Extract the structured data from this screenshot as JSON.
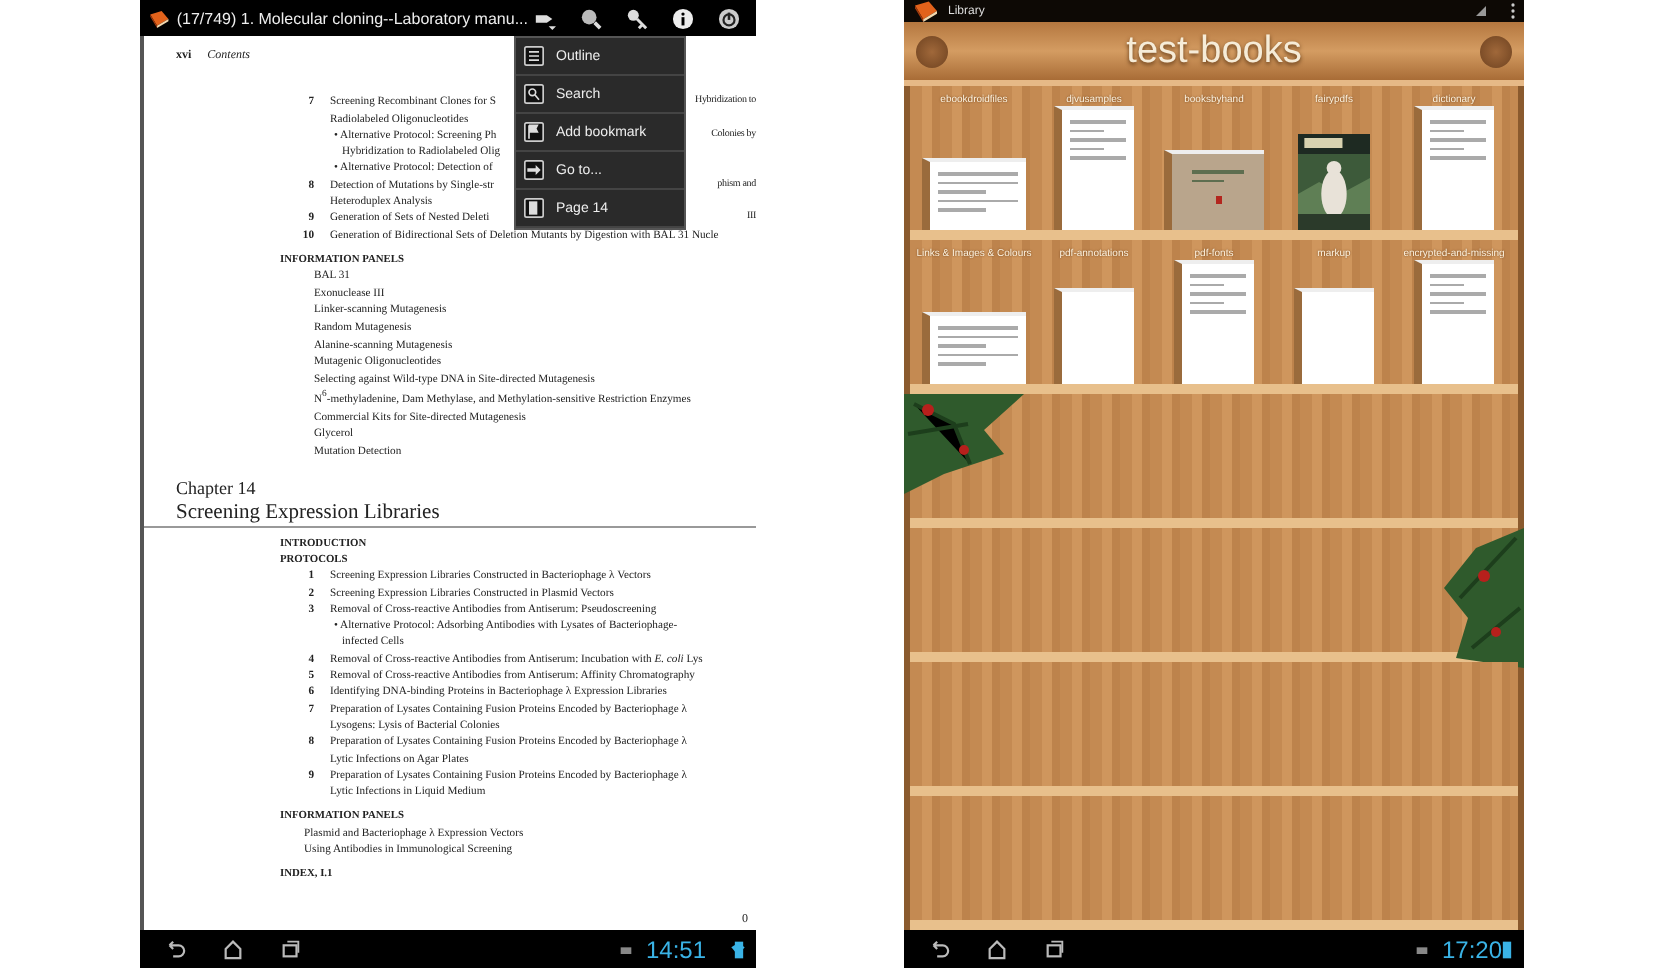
{
  "reader": {
    "title": "(17/749) 1. Molecular cloning--Laboratory manu...",
    "page": {
      "folio": "xvi",
      "running_head": "Contents",
      "entries": [
        {
          "kind": "item",
          "num": "7",
          "lines": [
            {
              "text": "Screening Recombinant Clones for S",
              "tail": "Hybridization to"
            },
            {
              "text": "Radiolabeled Oligonucleotides"
            }
          ]
        },
        {
          "kind": "bullet",
          "lines": [
            {
              "text": "• Alternative Protocol: Screening Ph",
              "tail": "Colonies by"
            },
            {
              "text": "Hybridization to Radiolabeled Olig"
            }
          ]
        },
        {
          "kind": "bullet",
          "lines": [
            {
              "text": "• Alternative Protocol: Detection of"
            }
          ]
        },
        {
          "kind": "item",
          "num": "8",
          "lines": [
            {
              "text": "Detection of Mutations by Single-str",
              "tail": "phism and"
            },
            {
              "text": "Heteroduplex Analysis"
            }
          ]
        },
        {
          "kind": "item",
          "num": "9",
          "lines": [
            {
              "text": "Generation of Sets of Nested Deleti",
              "tail": "III"
            }
          ]
        },
        {
          "kind": "item",
          "num": "10",
          "lines": [
            {
              "text": "Generation of Bidirectional Sets of Deletion Mutants by Digestion with BAL 31 Nucle"
            }
          ]
        },
        {
          "kind": "heading",
          "text": "INFORMATION PANELS"
        },
        {
          "kind": "panel",
          "text": "BAL 31"
        },
        {
          "kind": "panel",
          "text": "Exonuclease III"
        },
        {
          "kind": "panel",
          "text": "Linker-scanning Mutagenesis"
        },
        {
          "kind": "panel",
          "text": "Random Mutagenesis"
        },
        {
          "kind": "panel",
          "text": "Alanine-scanning Mutagenesis"
        },
        {
          "kind": "panel",
          "text": "Mutagenic Oligonucleotides"
        },
        {
          "kind": "panel",
          "text": "Selecting against Wild-type DNA in Site-directed Mutagenesis"
        },
        {
          "kind": "panel",
          "text": "N$^{6}$-methyladenine, Dam Methylase, and Methylation-sensitive Restriction Enzymes"
        },
        {
          "kind": "panel",
          "text": "Commercial Kits for Site-directed Mutagenesis"
        },
        {
          "kind": "panel",
          "text": "Glycerol"
        },
        {
          "kind": "panel",
          "text": "Mutation Detection"
        },
        {
          "kind": "chapter",
          "text": "Chapter 14"
        },
        {
          "kind": "title",
          "text": "Screening Expression Libraries"
        },
        {
          "kind": "heading",
          "text": "INTRODUCTION"
        },
        {
          "kind": "heading2",
          "text": "PROTOCOLS"
        },
        {
          "kind": "item",
          "num": "1",
          "lines": [
            {
              "text": "Screening Expression Libraries Constructed in Bacteriophage λ Vectors"
            }
          ]
        },
        {
          "kind": "item",
          "num": "2",
          "lines": [
            {
              "text": "Screening Expression Libraries Constructed in Plasmid Vectors"
            }
          ]
        },
        {
          "kind": "item",
          "num": "3",
          "lines": [
            {
              "text": "Removal of Cross-reactive Antibodies from Antiserum: Pseudoscreening"
            }
          ]
        },
        {
          "kind": "bullet",
          "lines": [
            {
              "text": "• Alternative Protocol: Adsorbing Antibodies with Lysates of Bacteriophage-"
            },
            {
              "text": "infected Cells"
            }
          ]
        },
        {
          "kind": "item",
          "num": "4",
          "lines": [
            {
              "text": "Removal of Cross-reactive Antibodies from Antiserum: Incubation with *E. coli* Lys"
            }
          ]
        },
        {
          "kind": "item",
          "num": "5",
          "lines": [
            {
              "text": "Removal of Cross-reactive Antibodies from Antiserum: Affinity Chromatography"
            }
          ]
        },
        {
          "kind": "item",
          "num": "6",
          "lines": [
            {
              "text": "Identifying DNA-binding Proteins in Bacteriophage λ Expression Libraries"
            }
          ]
        },
        {
          "kind": "item",
          "num": "7",
          "lines": [
            {
              "text": "Preparation of Lysates Containing Fusion Proteins Encoded by Bacteriophage λ"
            },
            {
              "text": "Lysogens: Lysis of Bacterial Colonies"
            }
          ]
        },
        {
          "kind": "item",
          "num": "8",
          "lines": [
            {
              "text": "Preparation of Lysates Containing Fusion Proteins Encoded by Bacteriophage λ"
            },
            {
              "text": "Lytic Infections on Agar Plates"
            }
          ]
        },
        {
          "kind": "item",
          "num": "9",
          "lines": [
            {
              "text": "Preparation of Lysates Containing Fusion Proteins Encoded by Bacteriophage λ"
            },
            {
              "text": "Lytic Infections in Liquid Medium"
            }
          ]
        },
        {
          "kind": "heading",
          "text": "INFORMATION PANELS"
        },
        {
          "kind": "panel2",
          "text": "Plasmid and Bacteriophage λ Expression Vectors"
        },
        {
          "kind": "panel2",
          "text": "Using Antibodies in Immunological Screening"
        },
        {
          "kind": "heading",
          "text": "INDEX, I.1"
        }
      ],
      "page_number": "0"
    },
    "menu": {
      "items": [
        {
          "label": "Outline"
        },
        {
          "label": "Search"
        },
        {
          "label": "Add bookmark"
        },
        {
          "label": "Go to..."
        },
        {
          "label": "Page 14"
        }
      ]
    },
    "status_bar": {
      "time": "14:51"
    }
  },
  "library": {
    "title": "Library",
    "shelf_name": "test-books",
    "shelves": [
      {
        "books": [
          {
            "label": "ebookdroidfiles",
            "kind": "wide"
          },
          {
            "label": "djvusamples",
            "kind": "page"
          },
          {
            "label": "booksbyhand",
            "kind": "cover"
          },
          {
            "label": "fairypdfs"
          },
          {
            "label": "dictionary",
            "kind": "page"
          }
        ]
      },
      {
        "books": [
          {
            "label": "Links & Images & Colours",
            "kind": "wide"
          },
          {
            "label": "pdf-annotations",
            "kind": "blank"
          },
          {
            "label": "pdf-fonts",
            "kind": "page"
          },
          {
            "label": "markup",
            "kind": "blank"
          },
          {
            "label": "encrypted-and-missing",
            "kind": "page"
          }
        ]
      }
    ],
    "status_bar": {
      "time": "17:20"
    }
  }
}
